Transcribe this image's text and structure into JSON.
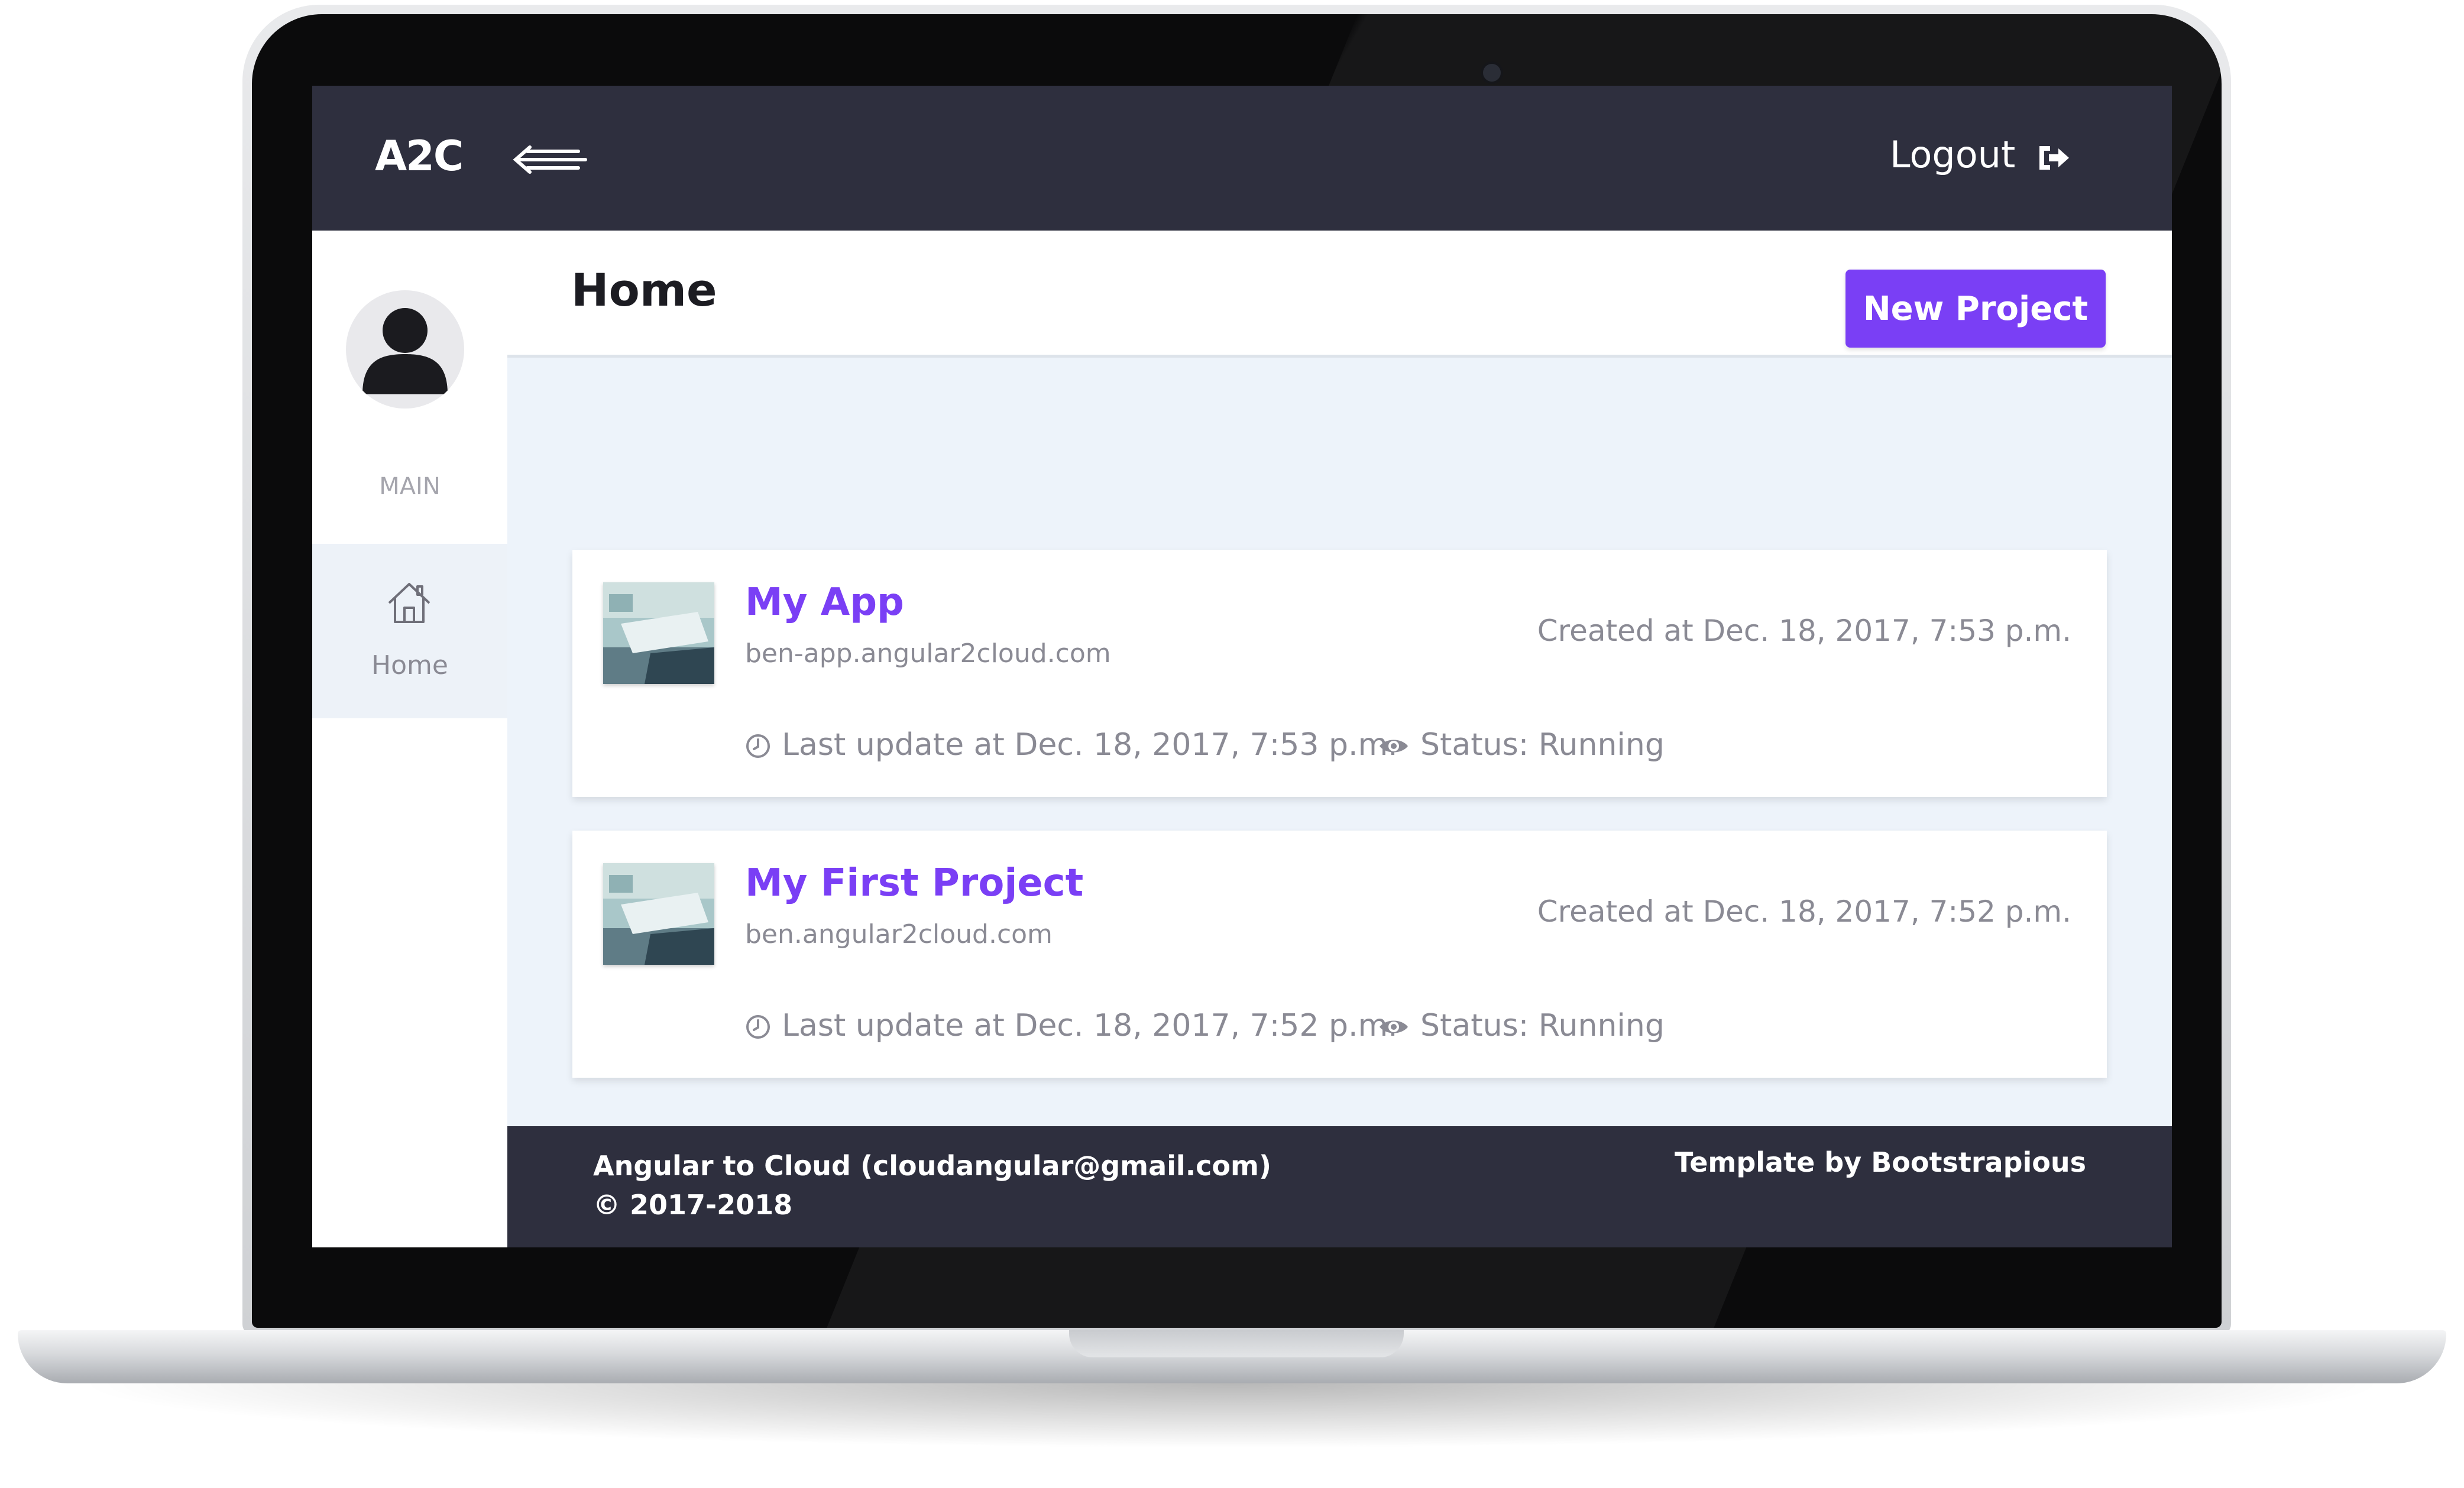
{
  "app": {
    "brand": "A2C"
  },
  "header": {
    "logout_label": "Logout",
    "menu_icon": "menu-arrow-icon",
    "logout_icon": "sign-out-icon"
  },
  "sidebar": {
    "section_heading": "MAIN",
    "items": [
      {
        "label": "Home",
        "icon": "home-icon",
        "active": true
      }
    ]
  },
  "page": {
    "title": "Home",
    "new_project_label": "New Project"
  },
  "projects": [
    {
      "name": "My App",
      "url": "ben-app.angular2cloud.com",
      "created": "Created at Dec. 18, 2017, 7:53 p.m.",
      "last_update": "Last update at Dec. 18, 2017, 7:53 p.m.",
      "status": "Status: Running"
    },
    {
      "name": "My First Project",
      "url": "ben.angular2cloud.com",
      "created": "Created at Dec. 18, 2017, 7:52 p.m.",
      "last_update": "Last update at Dec. 18, 2017, 7:52 p.m.",
      "status": "Status: Running"
    }
  ],
  "footer": {
    "left": "Angular to Cloud (cloudangular@gmail.com) © 2017-2018",
    "right": "Template by Bootstrapious"
  },
  "colors": {
    "accent": "#7a3ff5",
    "topbar": "#2e2f3e",
    "content_bg": "#edf3fa",
    "muted_text": "#8a8a94"
  }
}
